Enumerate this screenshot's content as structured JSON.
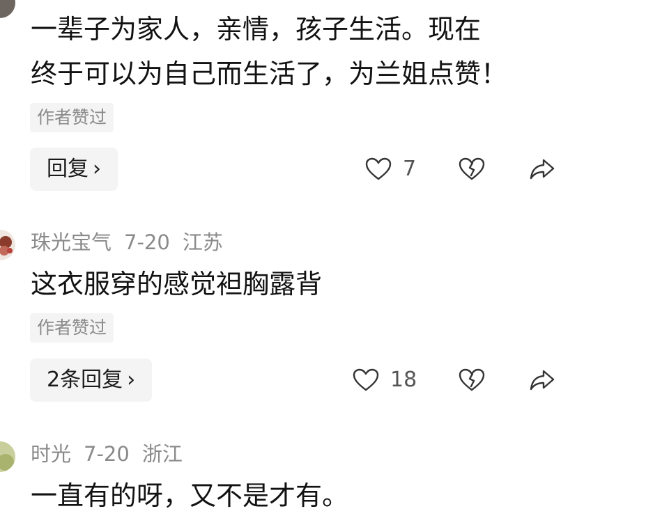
{
  "comments": [
    {
      "user": "",
      "date": "",
      "location": "",
      "text_lines": [
        "一辈子为家人，亲情，孩子生活。现在",
        "终于可以为自己而生活了，为兰姐点赞！"
      ],
      "badge": "作者赞过",
      "reply_label": "回复",
      "reply_chevron": "›",
      "likes": "7"
    },
    {
      "user": "珠光宝气",
      "date": "7-20",
      "location": "江苏",
      "text_lines": [
        "这衣服穿的感觉袒胸露背"
      ],
      "badge": "作者赞过",
      "reply_label": "2条回复",
      "reply_chevron": "›",
      "likes": "18"
    },
    {
      "user": "时光",
      "date": "7-20",
      "location": "浙江",
      "text_lines": [
        "一直有的呀，又不是才有。"
      ]
    }
  ],
  "icons": {
    "like": "heart-icon",
    "dislike": "broken-heart-icon",
    "share": "share-arrow-icon"
  },
  "colors": {
    "text": "#121212",
    "muted": "#8a8a8a",
    "chip_bg": "#f4f4f4",
    "icon": "#333333"
  }
}
